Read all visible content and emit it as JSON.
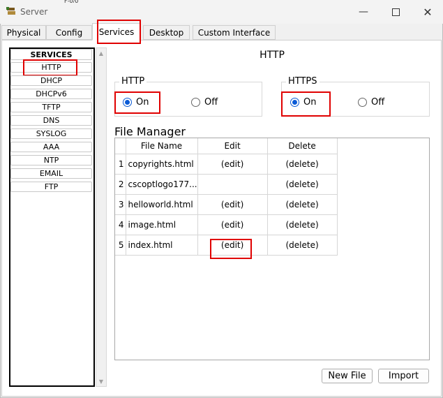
{
  "window": {
    "title": "Server",
    "peek_text": "F-0/0"
  },
  "tabs": [
    {
      "label": "Physical"
    },
    {
      "label": "Config"
    },
    {
      "label": "Services"
    },
    {
      "label": "Desktop"
    },
    {
      "label": "Custom Interface"
    }
  ],
  "services": {
    "header": "SERVICES",
    "items": [
      "HTTP",
      "DHCP",
      "DHCPv6",
      "TFTP",
      "DNS",
      "SYSLOG",
      "AAA",
      "NTP",
      "EMAIL",
      "FTP"
    ]
  },
  "panel": {
    "title": "HTTP",
    "http": {
      "label": "HTTP",
      "on_label": "On",
      "off_label": "Off",
      "selected": "On"
    },
    "https": {
      "label": "HTTPS",
      "on_label": "On",
      "off_label": "Off",
      "selected": "On"
    }
  },
  "file_manager": {
    "title": "File Manager",
    "columns": [
      "File Name",
      "Edit",
      "Delete"
    ],
    "rows": [
      {
        "num": "1",
        "name": "copyrights.html",
        "edit": "(edit)",
        "delete": "(delete)"
      },
      {
        "num": "2",
        "name": "cscoptlogo177...",
        "edit": "",
        "delete": "(delete)"
      },
      {
        "num": "3",
        "name": "helloworld.html",
        "edit": "(edit)",
        "delete": "(delete)"
      },
      {
        "num": "4",
        "name": "image.html",
        "edit": "(edit)",
        "delete": "(delete)"
      },
      {
        "num": "5",
        "name": "index.html",
        "edit": "(edit)",
        "delete": "(delete)"
      }
    ]
  },
  "buttons": {
    "new_file": "New File",
    "import": "Import"
  },
  "colors": {
    "highlight": "#e00000",
    "radio_selected": "#0a5bd6"
  }
}
